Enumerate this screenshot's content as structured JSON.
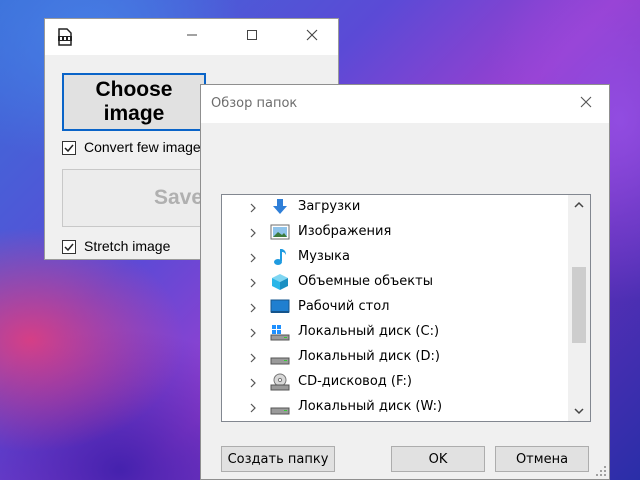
{
  "app_window": {
    "choose_button": "Choose image",
    "convert_checkbox": {
      "label": "Convert few images",
      "checked": true
    },
    "save_button": "Save",
    "stretch_checkbox": {
      "label": "Stretch image",
      "checked": true
    },
    "titlebar_icons": [
      "pdf-file-icon",
      "minimize-icon",
      "maximize-icon",
      "close-icon"
    ]
  },
  "dialog": {
    "title": "Обзор папок",
    "tree_items": [
      {
        "label": "Загрузки",
        "icon": "downloads-icon"
      },
      {
        "label": "Изображения",
        "icon": "pictures-icon"
      },
      {
        "label": "Музыка",
        "icon": "music-icon"
      },
      {
        "label": "Объемные объекты",
        "icon": "3d-objects-icon"
      },
      {
        "label": "Рабочий стол",
        "icon": "desktop-icon"
      },
      {
        "label": "Локальный диск (C:)",
        "icon": "windows-drive-icon"
      },
      {
        "label": "Локальный диск (D:)",
        "icon": "drive-icon"
      },
      {
        "label": "CD-дисковод (F:)",
        "icon": "cd-drive-icon"
      },
      {
        "label": "Локальный диск (W:)",
        "icon": "drive-icon"
      }
    ],
    "buttons": {
      "new_folder": "Создать папку",
      "ok": "OK",
      "cancel": "Отмена"
    }
  },
  "colors": {
    "accent_border": "#0a64c8",
    "window_bg": "#f0f0f0",
    "downloads_arrow": "#2f7fd8",
    "music_note": "#1f9be0",
    "cube": "#29b6e8"
  }
}
